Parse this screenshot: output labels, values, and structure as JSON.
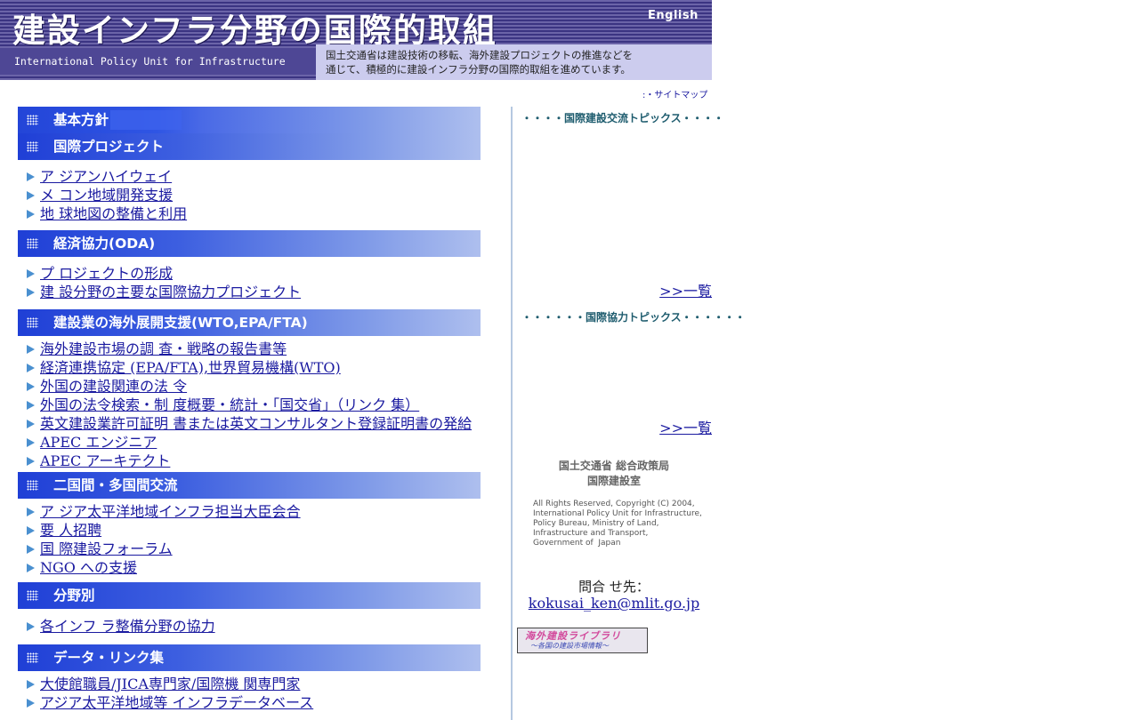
{
  "header": {
    "title": "建設インフラ分野の国際的取組",
    "english_link": "English",
    "subtitle": "International Policy Unit for Infrastructure",
    "description_line1": "国土交通省は建設技術の移転、海外建設プロジェクトの推進などを",
    "description_line2": "通じて、積極的に建設インフラ分野の国際的取組を進めています。"
  },
  "sitemap_link": ":・サイトマップ",
  "sections": {
    "kihon": "基本方針",
    "project": {
      "title": "国際プロジェクト",
      "links": [
        "ア ジアンハイウェイ",
        "メ コン地域開発支援",
        "地 球地図の整備と利用"
      ]
    },
    "oda": {
      "title": "経済協力(ODA)",
      "links": [
        "プ ロジェクトの形成",
        "建 設分野の主要な国際協力プロジェクト"
      ]
    },
    "kaigai": {
      "title": "建設業の海外展開支援(WTO,EPA/FTA)",
      "links": [
        "海外建設市場の調 査・戦略の報告書等",
        "経済連携協定 (EPA/FTA),世界貿易機構(WTO)",
        "外国の建設関連の法 令",
        "外国の法令検索・制 度概要・統計・「国交省」（リンク 集）",
        "英文建設業許可証明 書または英文コンサルタント登録証明書の発給",
        "APEC エンジニア",
        "APEC アーキテクト"
      ]
    },
    "kokusai": {
      "title": "二国間・多国間交流",
      "links": [
        "ア ジア太平洋地域インフラ担当大臣会合",
        "要 人招聘",
        "国 際建設フォーラム",
        "NGO への支援"
      ]
    },
    "bunya": {
      "title": "分野別",
      "links": [
        "各インフ ラ整備分野の協力"
      ]
    },
    "data": {
      "title": "データ・リンク集",
      "links": [
        "大使館職員/JICA専門家/国際機 関専門家",
        "アジア太平洋地域等 インフラデータベース"
      ]
    }
  },
  "right": {
    "topics1_heading": "・・・・国際建設交流トピックス・・・・",
    "topics1_more": ">>一覧",
    "topics2_heading": "・・・・・・国際協力トピックス・・・・・・",
    "topics2_more": ">>一覧",
    "org_line1": "国土交通省 総合政策局",
    "org_line2": "国際建設室",
    "copyright": "All Rights Reserved, Copyright (C) 2004,\nInternational Policy Unit for Infrastructure,\nPolicy Bureau, Ministry of Land,\nInfrastructure and Transport,\nGovernment of  Japan",
    "contact_heading": "問合 せ先：",
    "contact_email": "kokusai_ken@mlit.go.jp",
    "banner_title": "海外建設ライブラリ",
    "banner_sub": "～各国の建設市場情報～"
  }
}
